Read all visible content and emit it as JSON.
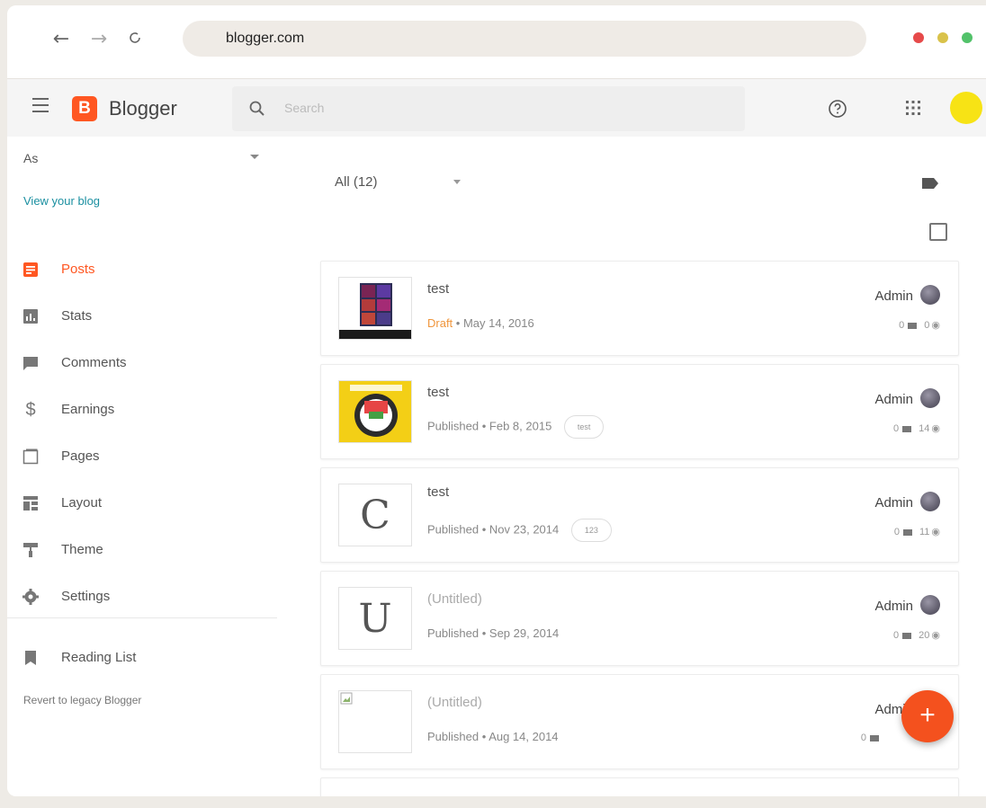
{
  "browser": {
    "url": "blogger.com",
    "colors": {
      "close": "#e64a4a",
      "minimize": "#d9c24a",
      "maximize": "#52c26a"
    }
  },
  "header": {
    "app_name": "Blogger",
    "logo_letter": "B",
    "search_placeholder": "Search",
    "brand_color": "#ff5722"
  },
  "sidebar": {
    "blog_name": "As",
    "view_blog": "View your blog",
    "items": [
      {
        "label": "Posts",
        "icon": "posts-icon",
        "active": true
      },
      {
        "label": "Stats",
        "icon": "stats-icon"
      },
      {
        "label": "Comments",
        "icon": "comments-icon"
      },
      {
        "label": "Earnings",
        "icon": "earnings-icon"
      },
      {
        "label": "Pages",
        "icon": "pages-icon"
      },
      {
        "label": "Layout",
        "icon": "layout-icon"
      },
      {
        "label": "Theme",
        "icon": "theme-icon"
      },
      {
        "label": "Settings",
        "icon": "settings-icon"
      }
    ],
    "reading_list": "Reading List",
    "legacy_link": "Revert to legacy Blogger"
  },
  "main": {
    "filter_label": "All (12)",
    "posts": [
      {
        "title": "test",
        "status": "Draft",
        "date": "May 14, 2016",
        "tag": "",
        "author": "Admin",
        "comments": "0",
        "views": "0",
        "thumb": "image"
      },
      {
        "title": "test",
        "status": "Published",
        "date": "Feb 8, 2015",
        "tag": "test",
        "author": "Admin",
        "comments": "0",
        "views": "14",
        "thumb": "image"
      },
      {
        "title": "test",
        "status": "Published",
        "date": "Nov 23, 2014",
        "tag": "123",
        "author": "Admin",
        "comments": "0",
        "views": "11",
        "thumb": "C"
      },
      {
        "title": "(Untitled)",
        "status": "Published",
        "date": "Sep 29, 2014",
        "tag": "",
        "author": "Admin",
        "comments": "0",
        "views": "20",
        "thumb": "U"
      },
      {
        "title": "(Untitled)",
        "status": "Published",
        "date": "Aug 14, 2014",
        "tag": "",
        "author": "Admin",
        "comments": "0",
        "views": "",
        "thumb": "broken"
      }
    ],
    "fab_label": "+"
  }
}
